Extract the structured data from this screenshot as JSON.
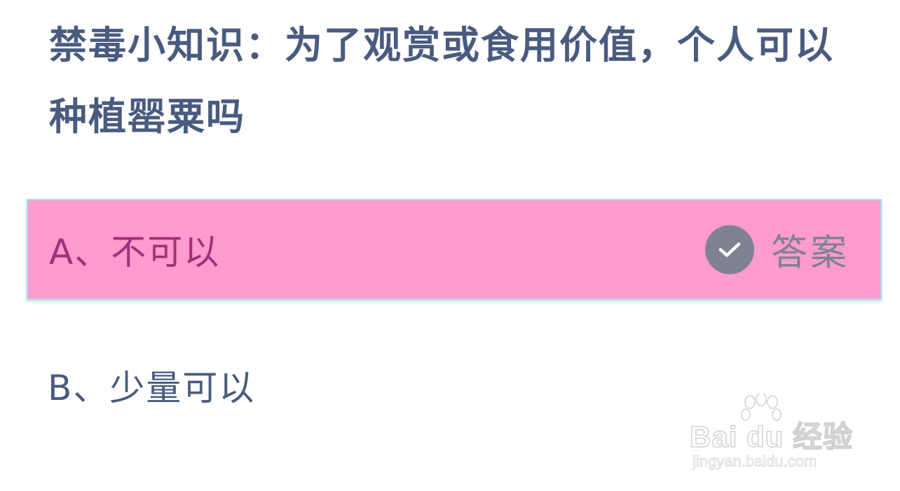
{
  "question": {
    "text": "禁毒小知识：为了观赏或食用价值，个人可以种植罂粟吗"
  },
  "options": [
    {
      "label": "A、不可以",
      "is_answer": true,
      "answer_text": "答案"
    },
    {
      "label": "B、少量可以",
      "is_answer": false
    }
  ],
  "icons": {
    "answer": "check-circle-icon",
    "watermark": "paw-icon"
  },
  "colors": {
    "question": "#4a5b80",
    "answer_bg": "#ff9bcf",
    "answer_border": "#a9dcf0",
    "answer_label": "#a0317a",
    "answer_mark": "#7f8291"
  },
  "watermark": {
    "brand": "Bai du 经验",
    "url": "jingyan.baidu.com"
  }
}
